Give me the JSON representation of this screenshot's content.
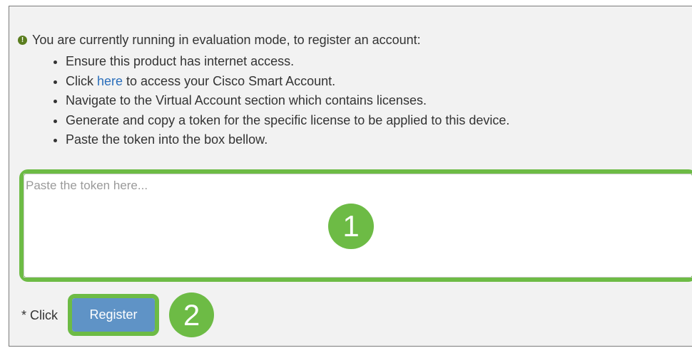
{
  "notice": {
    "text": "You are currently running in evaluation mode, to register an account:",
    "icon": "info-icon"
  },
  "steps": [
    {
      "text": "Ensure this product has internet access."
    },
    {
      "prefix": "Click ",
      "link": "here",
      "suffix": " to access your Cisco Smart Account."
    },
    {
      "text": "Navigate to the Virtual Account section which contains licenses."
    },
    {
      "text": "Generate and copy a token for the specific license to be applied to this device."
    },
    {
      "text": "Paste the token into the box bellow."
    }
  ],
  "token": {
    "placeholder": "Paste the token here...",
    "value": ""
  },
  "register": {
    "note": "* Click",
    "button_label": "Register"
  },
  "callouts": {
    "one": "1",
    "two": "2"
  },
  "colors": {
    "highlight": "#6dbb45",
    "button": "#5f93c6",
    "link": "#2a6ebb",
    "panel": "#f2f2f2"
  }
}
